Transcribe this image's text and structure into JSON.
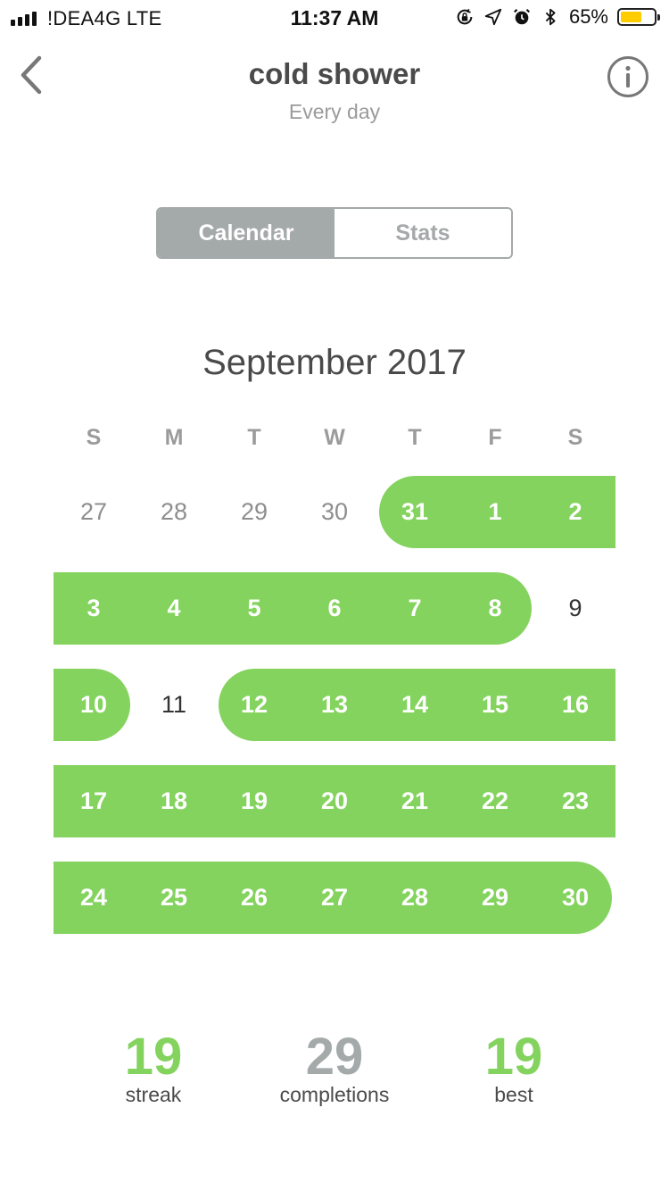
{
  "status_bar": {
    "carrier": "!DEA4G  LTE",
    "time": "11:37 AM",
    "battery_percent": "65%",
    "battery_level": 0.65,
    "icons": [
      "signal-bars-icon",
      "orientation-lock-icon",
      "location-arrow-icon",
      "alarm-icon",
      "bluetooth-icon",
      "battery-icon"
    ]
  },
  "header": {
    "title": "cold shower",
    "subtitle": "Every day",
    "back_icon": "chevron-left-icon",
    "info_icon": "info-circle-icon"
  },
  "tabs": {
    "calendar": "Calendar",
    "stats": "Stats",
    "active": "calendar"
  },
  "calendar": {
    "month_title": "September 2017",
    "weekdays": [
      "S",
      "M",
      "T",
      "W",
      "T",
      "F",
      "S"
    ],
    "weeks": [
      [
        {
          "label": "27",
          "state": "other"
        },
        {
          "label": "28",
          "state": "other"
        },
        {
          "label": "29",
          "state": "other"
        },
        {
          "label": "30",
          "state": "other"
        },
        {
          "label": "31",
          "state": "done"
        },
        {
          "label": "1",
          "state": "done"
        },
        {
          "label": "2",
          "state": "done"
        }
      ],
      [
        {
          "label": "3",
          "state": "done"
        },
        {
          "label": "4",
          "state": "done"
        },
        {
          "label": "5",
          "state": "done"
        },
        {
          "label": "6",
          "state": "done"
        },
        {
          "label": "7",
          "state": "done"
        },
        {
          "label": "8",
          "state": "done"
        },
        {
          "label": "9",
          "state": "missed"
        }
      ],
      [
        {
          "label": "10",
          "state": "done"
        },
        {
          "label": "11",
          "state": "missed"
        },
        {
          "label": "12",
          "state": "done"
        },
        {
          "label": "13",
          "state": "done"
        },
        {
          "label": "14",
          "state": "done"
        },
        {
          "label": "15",
          "state": "done"
        },
        {
          "label": "16",
          "state": "done"
        }
      ],
      [
        {
          "label": "17",
          "state": "done"
        },
        {
          "label": "18",
          "state": "done"
        },
        {
          "label": "19",
          "state": "done"
        },
        {
          "label": "20",
          "state": "done"
        },
        {
          "label": "21",
          "state": "done"
        },
        {
          "label": "22",
          "state": "done"
        },
        {
          "label": "23",
          "state": "done"
        }
      ],
      [
        {
          "label": "24",
          "state": "done"
        },
        {
          "label": "25",
          "state": "done"
        },
        {
          "label": "26",
          "state": "done"
        },
        {
          "label": "27",
          "state": "done"
        },
        {
          "label": "28",
          "state": "done"
        },
        {
          "label": "29",
          "state": "done"
        },
        {
          "label": "30",
          "state": "done"
        }
      ]
    ]
  },
  "stats": {
    "streak": {
      "value": "19",
      "label": "streak"
    },
    "completions": {
      "value": "29",
      "label": "completions"
    },
    "best": {
      "value": "19",
      "label": "best"
    }
  },
  "colors": {
    "accent_green": "#84d35e",
    "gray": "#a4a9a9",
    "text_dark": "#4a4a4a",
    "text_muted": "#9b9b9b",
    "battery_yellow": "#ffcc00"
  }
}
